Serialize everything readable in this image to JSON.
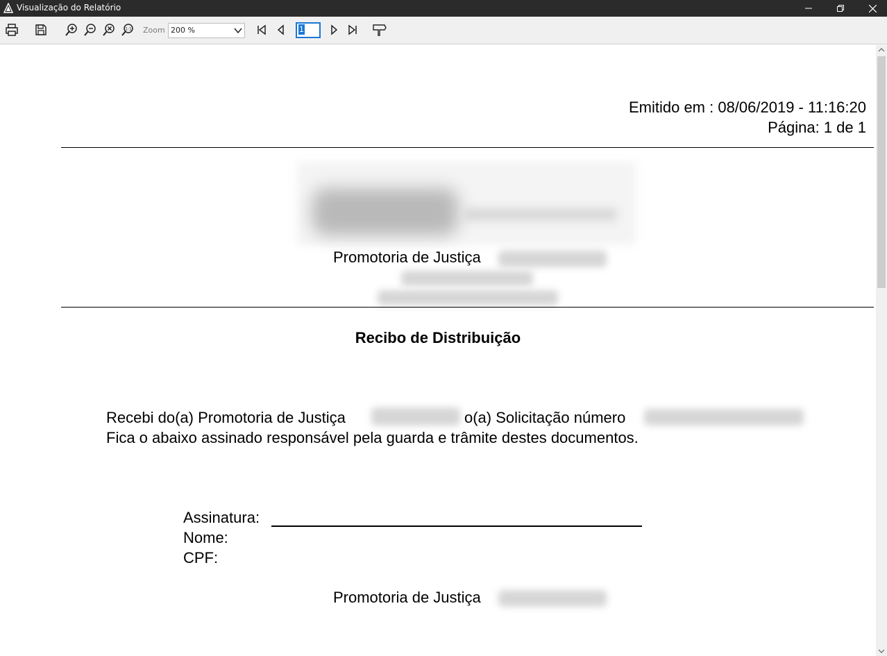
{
  "window": {
    "title": "Visualização do Relatório"
  },
  "toolbar": {
    "zoom_label": "Zoom",
    "zoom_value": "200 %",
    "page_value": "1",
    "icons": [
      "printer-icon",
      "save-icon",
      "zoom-in-icon",
      "zoom-out-icon",
      "zoom-fit-icon",
      "zoom-actual-size-icon",
      "first-page-icon",
      "previous-page-icon",
      "next-page-icon",
      "last-page-icon",
      "highlight-icon"
    ]
  },
  "document": {
    "emitted": "Emitido em : 08/06/2019 - 11:16:20",
    "page_info": "Página: 1 de 1",
    "org_line": "Promotoria de Justiça",
    "heading": "Recibo de Distribuição",
    "body_line1_a": "Recebi do(a) Promotoria de Justiça",
    "body_line1_b": "o(a) Solicitação número",
    "body_line2": "Fica o abaixo assinado responsável pela guarda e trâmite destes documentos.",
    "signature_label": "Assinatura:",
    "name_label": "Nome:",
    "cpf_label": "CPF:",
    "footer_org": "Promotoria de Justiça"
  },
  "colors": {
    "titlebar": "#2b2b2b",
    "toolbar": "#f0f0f0",
    "accent": "#1a78d4"
  }
}
